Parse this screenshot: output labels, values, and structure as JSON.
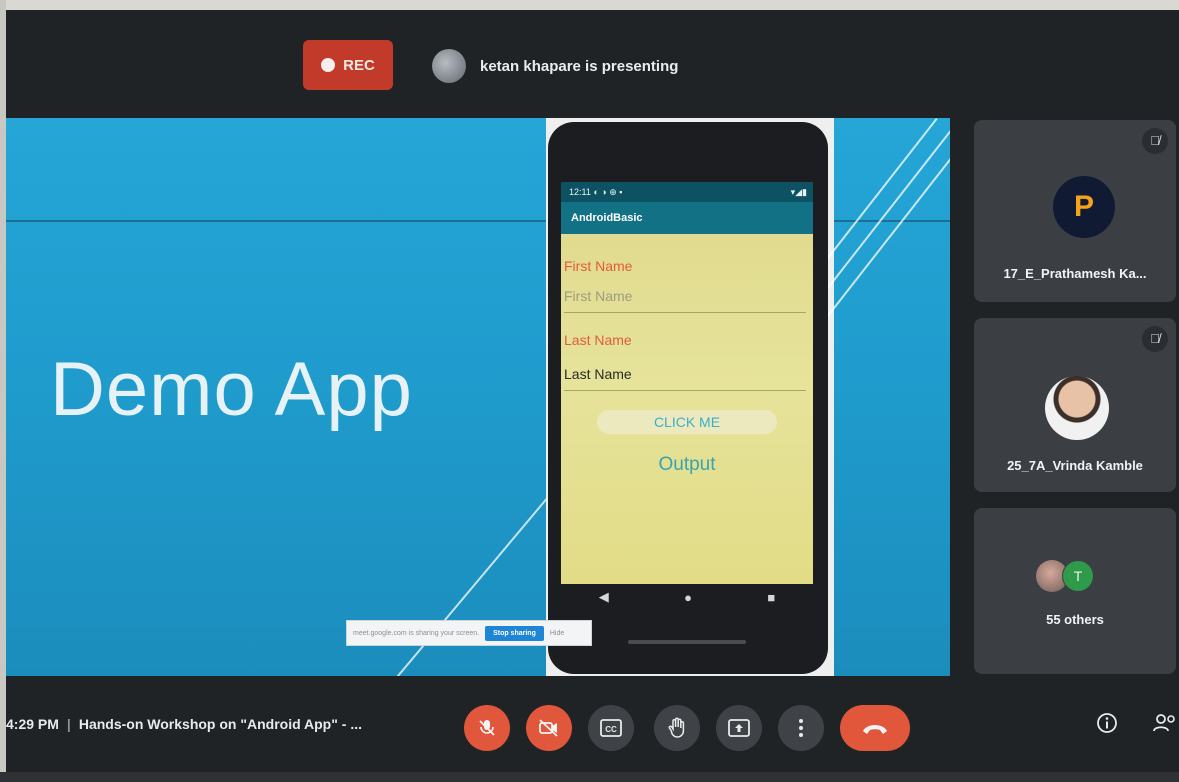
{
  "recording": {
    "label": "REC"
  },
  "presenter": {
    "text": "ketan khapare is presenting"
  },
  "slide": {
    "title": "Demo App",
    "phone": {
      "status_time": "12:11 ◐ ◑ ⊕ ▪",
      "status_icons": "▾◢▮",
      "app_title": "AndroidBasic",
      "first_name_label": "First Name",
      "first_name_placeholder": "First Name",
      "last_name_label": "Last Name",
      "last_name_value": "Last Name",
      "button_label": "CLICK ME",
      "output_text": "Output",
      "nav_back": "◀",
      "nav_home": "●",
      "nav_recent": "■"
    },
    "share_bar": {
      "message": "meet.google.com is sharing your screen.",
      "stop_label": "Stop sharing",
      "hide_label": "Hide"
    }
  },
  "participants": [
    {
      "name": "17_E_Prathamesh Ka...",
      "avatar_letter": "P",
      "muted": true
    },
    {
      "name": "25_7A_Vrinda Kamble",
      "muted": true
    },
    {
      "name": "55 others",
      "extra_avatar_letter": "T"
    }
  ],
  "bottom_bar": {
    "time": "4:29 PM",
    "separator": "|",
    "meeting_title": "Hands-on Workshop on \"Android App\" - ...",
    "icons": {
      "mic": "mic-off-icon",
      "camera": "camera-off-icon",
      "captions": "captions-icon",
      "hand": "raise-hand-icon",
      "present": "present-icon",
      "more": "more-options-icon",
      "end": "end-call-icon",
      "info": "info-icon",
      "people": "people-icon"
    }
  },
  "colors": {
    "rec_red": "#c23b2a",
    "control_red": "#e0573b",
    "slide_blue": "#1f9ccd",
    "tile_grey": "#3b3f44"
  }
}
